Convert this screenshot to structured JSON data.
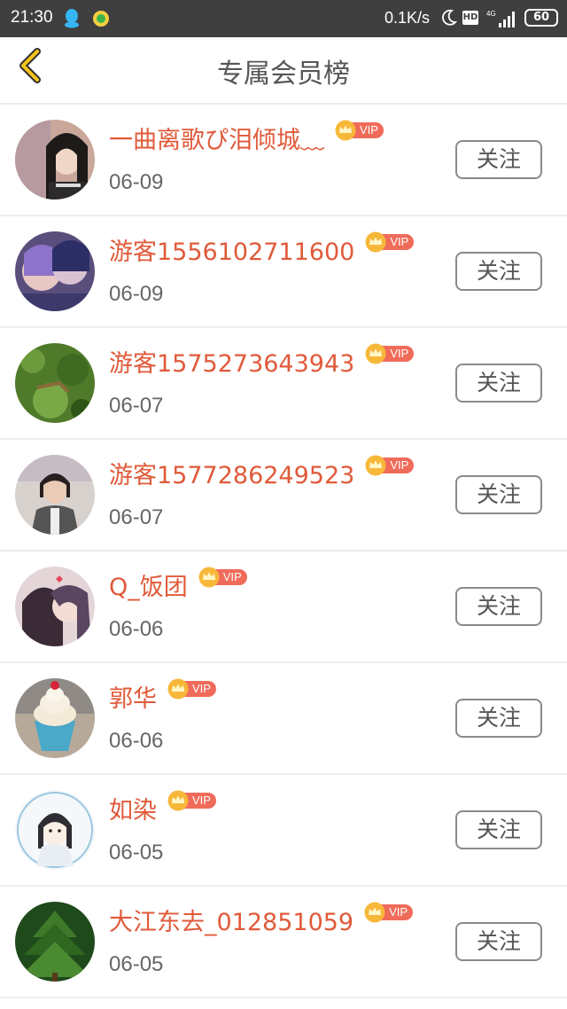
{
  "status_bar": {
    "time": "21:30",
    "net_speed": "0.1K/s",
    "hd_label": "HD",
    "network": "4G",
    "battery": "60",
    "icons": [
      "qq-icon",
      "app-icon",
      "moon-icon",
      "signal-icon",
      "battery-icon"
    ]
  },
  "header": {
    "title": "专属会员榜",
    "back_icon": "chevron-left-icon",
    "accent_color": "#f5c518"
  },
  "colors": {
    "name": "#e05a3a",
    "vip_tag": "#f06b5a",
    "crown": "#f7b83a"
  },
  "members": [
    {
      "name": "一曲离歌ぴ泪倾城﹏",
      "badge": "VIP",
      "date": "06-09",
      "action": "关注"
    },
    {
      "name": "游客1556102711600",
      "badge": "VIP",
      "date": "06-09",
      "action": "关注"
    },
    {
      "name": "游客1575273643943",
      "badge": "VIP",
      "date": "06-07",
      "action": "关注"
    },
    {
      "name": "游客1577286249523",
      "badge": "VIP",
      "date": "06-07",
      "action": "关注"
    },
    {
      "name": "Q_饭团",
      "badge": "VIP",
      "date": "06-06",
      "action": "关注"
    },
    {
      "name": "郭华",
      "badge": "VIP",
      "date": "06-06",
      "action": "关注"
    },
    {
      "name": "如染",
      "badge": "VIP",
      "date": "06-05",
      "action": "关注"
    },
    {
      "name": "大江东去_012851059",
      "badge": "VIP",
      "date": "06-05",
      "action": "关注"
    }
  ]
}
